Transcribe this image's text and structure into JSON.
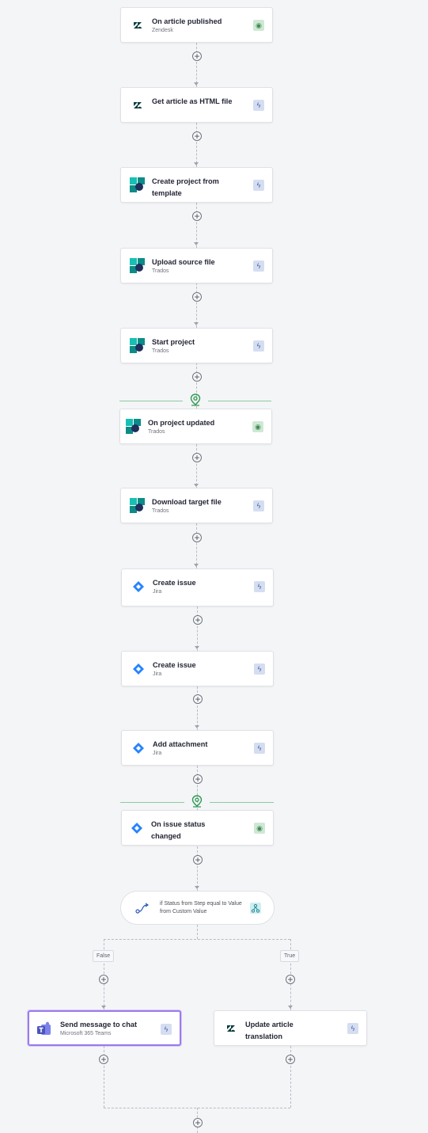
{
  "nodes": [
    {
      "title": "On article published",
      "sub": "Zendesk",
      "kind": "trigger",
      "app": "zendesk"
    },
    {
      "title": "Get article as HTML file",
      "sub": "",
      "kind": "action",
      "app": "zendesk"
    },
    {
      "title": "Create project from template",
      "sub": "",
      "kind": "action",
      "app": "trados"
    },
    {
      "title": "Upload source file",
      "sub": "Trados",
      "kind": "action",
      "app": "trados"
    },
    {
      "title": "Start project",
      "sub": "Trados",
      "kind": "action",
      "app": "trados"
    },
    {
      "title": "On project updated",
      "sub": "Trados",
      "kind": "trigger",
      "app": "trados"
    },
    {
      "title": "Download target file",
      "sub": "Trados",
      "kind": "action",
      "app": "trados"
    },
    {
      "title": "Create issue",
      "sub": "Jira",
      "kind": "action",
      "app": "jira"
    },
    {
      "title": "Create issue",
      "sub": "Jira",
      "kind": "action",
      "app": "jira"
    },
    {
      "title": "Add attachment",
      "sub": "Jira",
      "kind": "action",
      "app": "jira"
    },
    {
      "title": "On issue status changed",
      "sub": "",
      "kind": "trigger",
      "app": "jira"
    }
  ],
  "condition": {
    "text": "if Status from Step equal to Value from Custom Value"
  },
  "branches": {
    "false_label": "False",
    "true_label": "True",
    "false_node": {
      "title": "Send message to chat",
      "sub": "Microsoft 365 Teams",
      "kind": "action",
      "app": "teams"
    },
    "true_node": {
      "title": "Update article translation",
      "sub": "",
      "kind": "action",
      "app": "zendesk"
    }
  },
  "icons": {
    "trigger_badge": "rss-icon",
    "action_badge": "lightning-icon",
    "checkpoint": "map-pin-icon",
    "condition": "branch-icon"
  },
  "colors": {
    "trigger_badge_bg": "#cfe8d5",
    "action_badge_bg": "#d5ddf1",
    "selected_border": "#9b7be8",
    "checkpoint": "#2e9a52"
  }
}
